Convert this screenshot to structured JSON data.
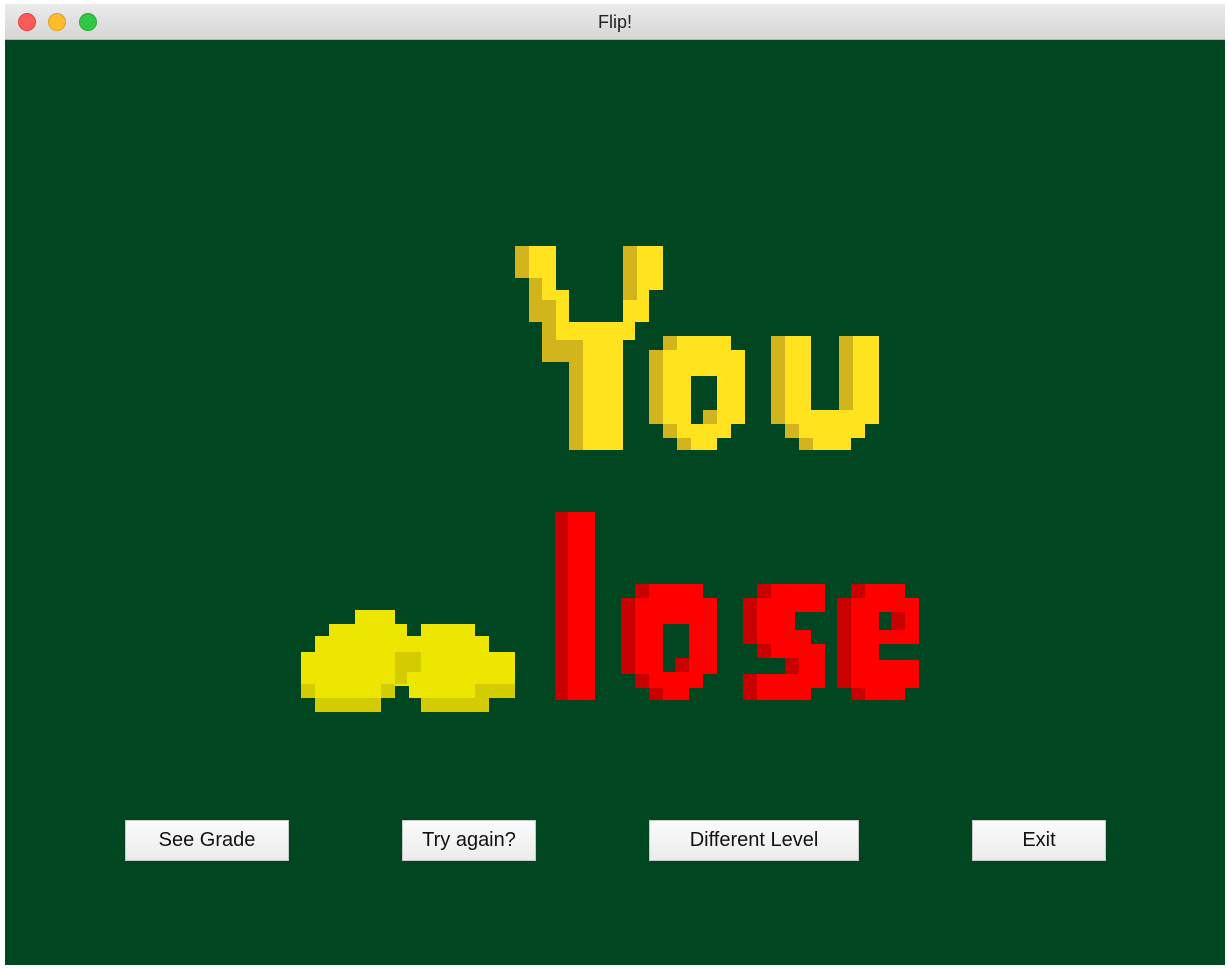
{
  "window": {
    "title": "Flip!"
  },
  "message": {
    "line1": "You",
    "line2": "lose",
    "line1_color": "#ffe31f",
    "line2_color": "#ff0000"
  },
  "colors": {
    "background": "#004620",
    "bottom_tile": "#ece600"
  },
  "buttons": {
    "see_grade": "See Grade",
    "try_again": "Try again?",
    "different_level": "Different Level",
    "exit": "Exit"
  }
}
